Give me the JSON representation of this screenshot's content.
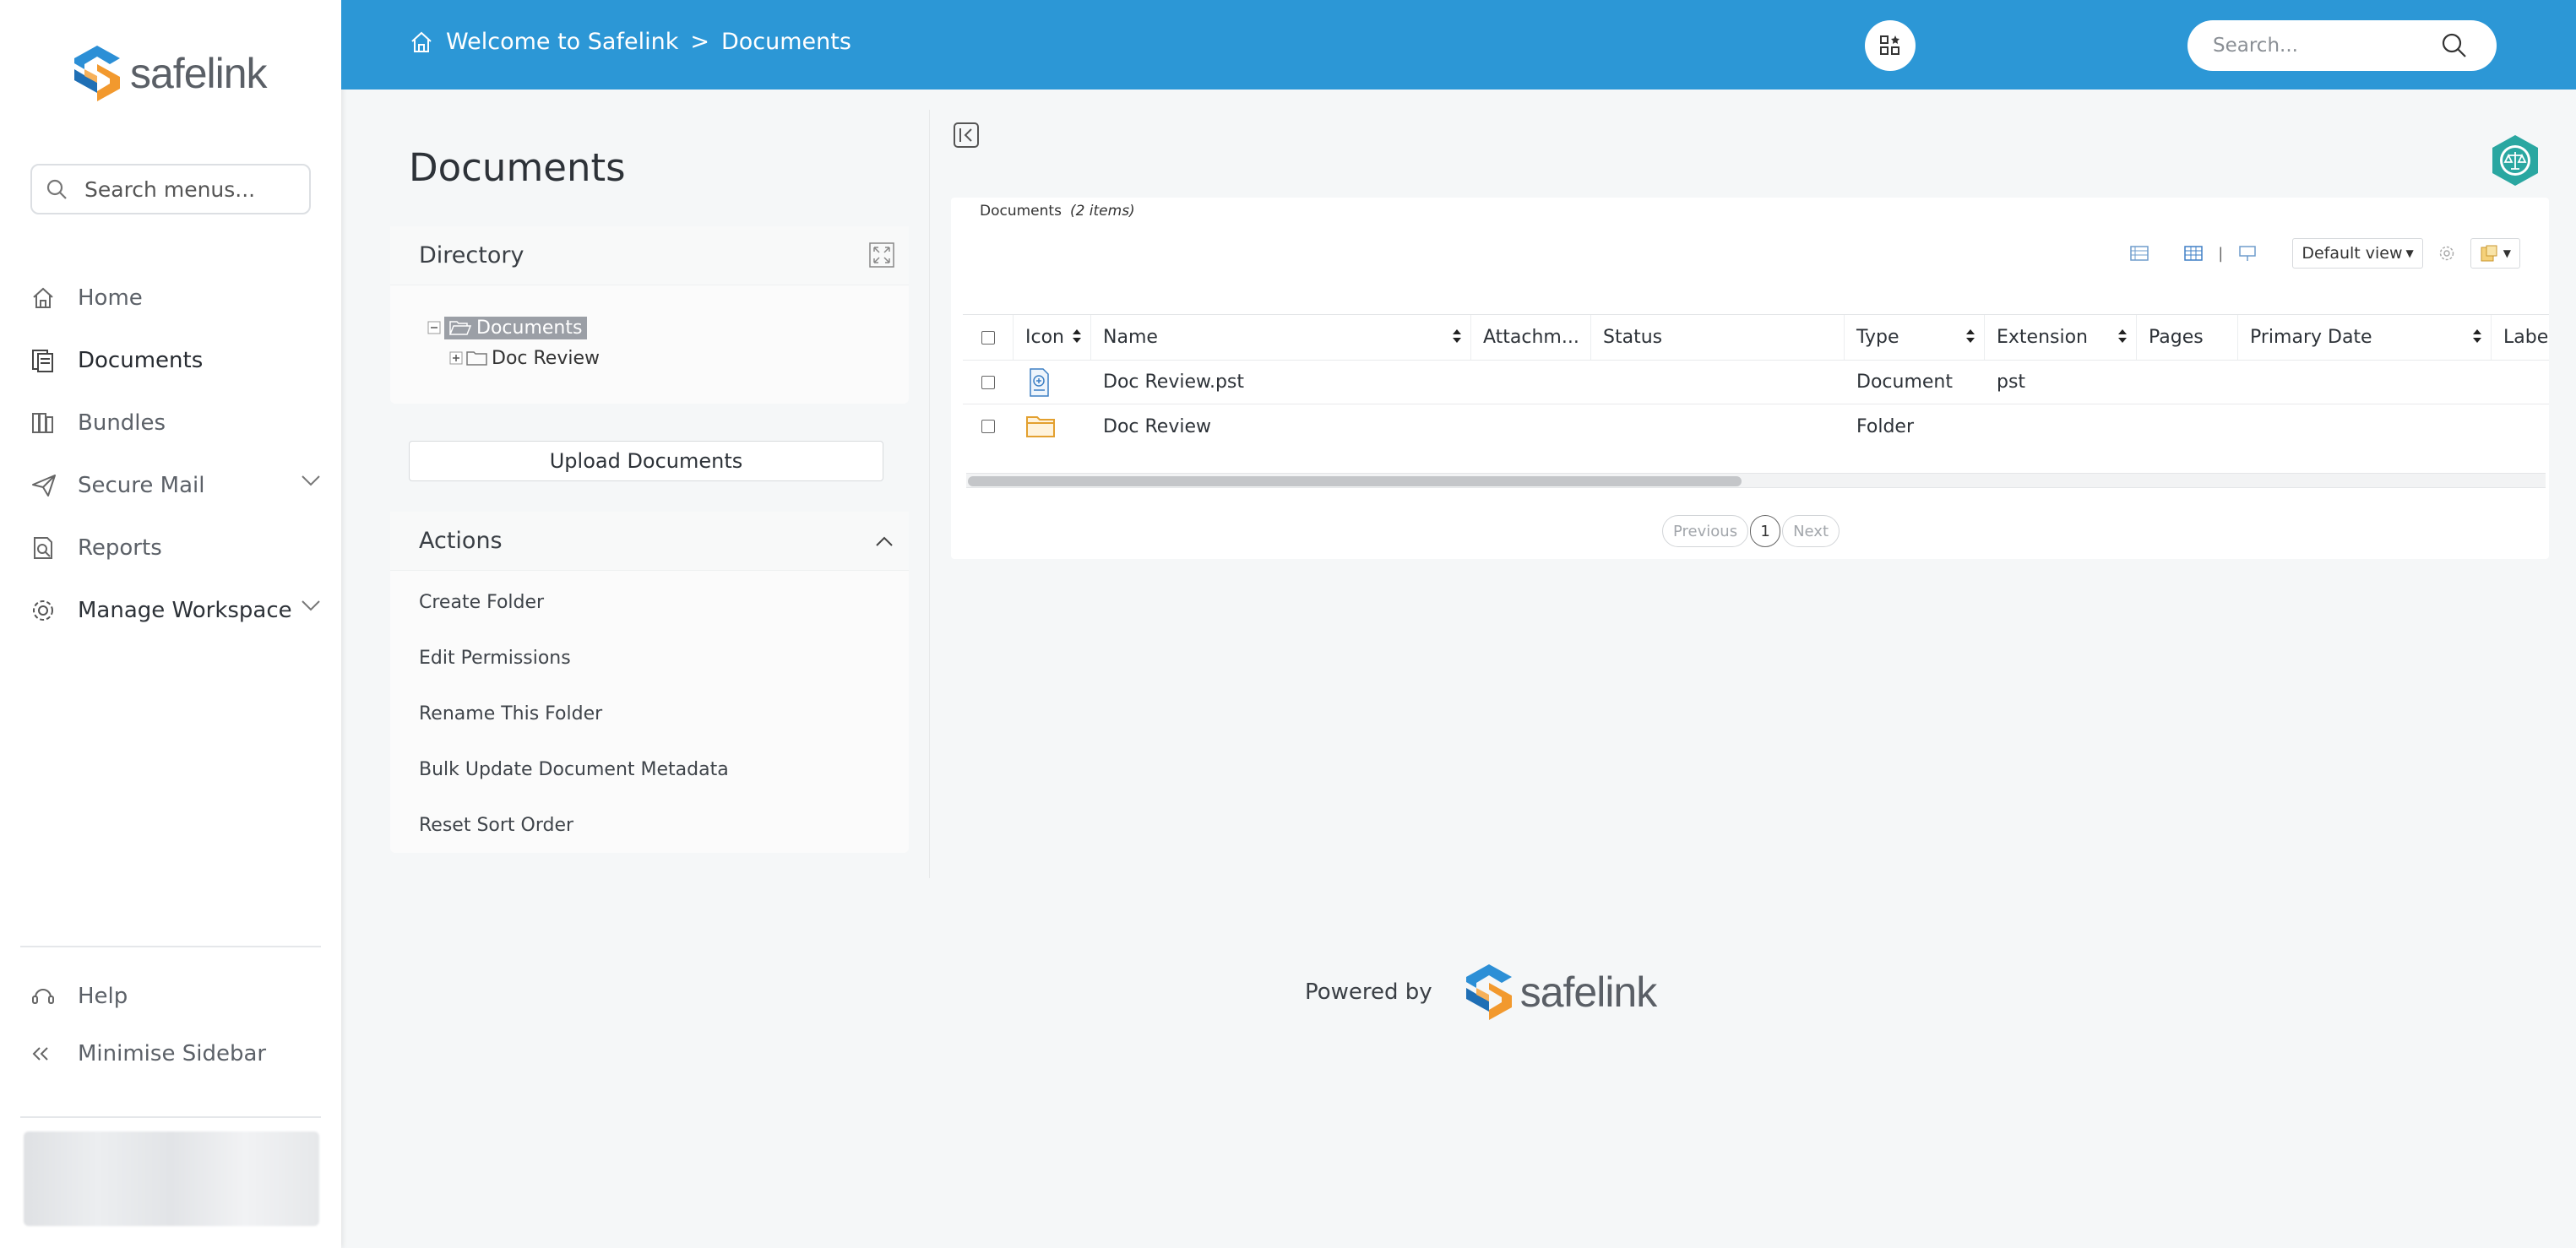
{
  "app": {
    "logo_text": "safelink",
    "brand_colors": {
      "header": "#2c97d6",
      "logo_blue": "#2c8fd6",
      "logo_orange": "#f2992e",
      "accent_teal": "#2aa7a1"
    }
  },
  "sidebar": {
    "search_placeholder": "Search menus...",
    "items": [
      {
        "label": "Home",
        "icon": "home-icon"
      },
      {
        "label": "Documents",
        "icon": "documents-icon"
      },
      {
        "label": "Bundles",
        "icon": "bundles-icon"
      },
      {
        "label": "Secure Mail",
        "icon": "send-icon"
      },
      {
        "label": "Reports",
        "icon": "reports-icon"
      },
      {
        "label": "Manage Workspace",
        "icon": "gear-icon"
      }
    ],
    "help_label": "Help",
    "minimise_label": "Minimise Sidebar"
  },
  "header": {
    "breadcrumb_root": "Welcome to Safelink",
    "breadcrumb_sep": ">",
    "breadcrumb_current": "Documents",
    "search_placeholder": "Search..."
  },
  "left": {
    "page_title": "Documents",
    "directory_title": "Directory",
    "tree": {
      "root": "Documents",
      "child": "Doc Review"
    },
    "upload_label": "Upload Documents",
    "actions_title": "Actions",
    "actions": [
      "Create Folder",
      "Edit Permissions",
      "Rename This Folder",
      "Bulk Update Document Metadata",
      "Reset Sort Order"
    ]
  },
  "main": {
    "card_title": "Documents",
    "card_count": "(2 items)",
    "view_label": "Default view",
    "toolbar_sep": "|",
    "columns": [
      "Icon",
      "Name",
      "Attachm...",
      "Status",
      "Type",
      "Extension",
      "Pages",
      "Primary Date",
      "Labe"
    ],
    "rows": [
      {
        "icon": "document-icon",
        "name": "Doc Review.pst",
        "attach": "",
        "status": "",
        "type": "Document",
        "ext": "pst",
        "pages": "",
        "date": ""
      },
      {
        "icon": "folder-icon",
        "name": "Doc Review",
        "attach": "",
        "status": "",
        "type": "Folder",
        "ext": "",
        "pages": "",
        "date": ""
      }
    ],
    "pager": {
      "prev": "Previous",
      "page": "1",
      "next": "Next"
    }
  },
  "footer": {
    "powered_by": "Powered by",
    "logo_text": "safelink"
  }
}
